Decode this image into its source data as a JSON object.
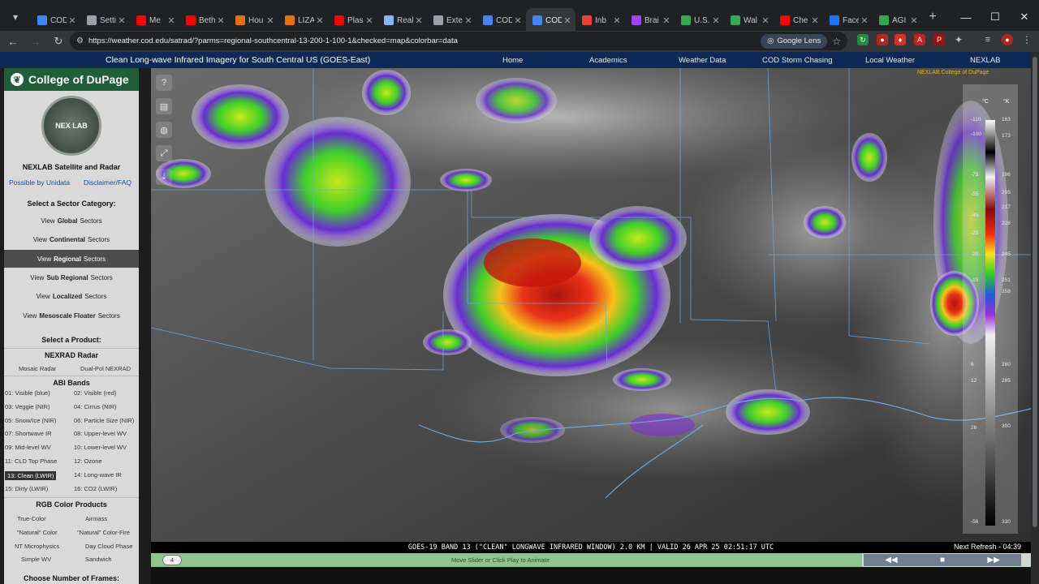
{
  "browser": {
    "tabs": [
      {
        "label": "COD",
        "color": "#4285f4"
      },
      {
        "label": "Setti",
        "color": "#9aa0a6"
      },
      {
        "label": "Me",
        "color": "#ff0000"
      },
      {
        "label": "Beth",
        "color": "#ff0000"
      },
      {
        "label": "Hou",
        "color": "#e8710a"
      },
      {
        "label": "LIZA",
        "color": "#e8710a"
      },
      {
        "label": "Plas",
        "color": "#ff0000"
      },
      {
        "label": "Real",
        "color": "#8ab4f8"
      },
      {
        "label": "Exte",
        "color": "#9aa0a6"
      },
      {
        "label": "COD",
        "color": "#4285f4"
      },
      {
        "label": "COD",
        "color": "#4285f4"
      },
      {
        "label": "Inb",
        "color": "#ea4335"
      },
      {
        "label": "Brai",
        "color": "#a142f4"
      },
      {
        "label": "U.S.",
        "color": "#34a853"
      },
      {
        "label": "Wal",
        "color": "#34a853"
      },
      {
        "label": "Che",
        "color": "#ff0000"
      },
      {
        "label": "Face",
        "color": "#1877f2"
      },
      {
        "label": "AGI",
        "color": "#34a853"
      }
    ],
    "url": "https://weather.cod.edu/satrad/?parms=regional-southcentral-13-200-1-100-1&checked=map&colorbar=data",
    "lens_label": "Google Lens"
  },
  "site": {
    "title": "Clean Long-wave Infrared Imagery for South Central US (GOES-East)",
    "nav": [
      "Home",
      "Academics",
      "Weather Data",
      "COD Storm Chasing",
      "Local Weather",
      "NEXLAB"
    ]
  },
  "sidebar": {
    "brand": "College of DuPage",
    "logo_text": "NEX LAB",
    "heading": "NEXLAB Satellite and Radar",
    "link_unidata": "Possible by Unidata",
    "link_disclaimer": "Disclaimer/FAQ",
    "sector_category_label": "Select a Sector Category:",
    "sectors": [
      {
        "pre": "View",
        "bold": "Global",
        "post": "Sectors"
      },
      {
        "pre": "View",
        "bold": "Continental",
        "post": "Sectors"
      },
      {
        "pre": "View",
        "bold": "Regional",
        "post": "Sectors"
      },
      {
        "pre": "View",
        "bold": "Sub Regional",
        "post": "Sectors"
      },
      {
        "pre": "View",
        "bold": "Localized",
        "post": "Sectors"
      },
      {
        "pre": "View",
        "bold": "Mesoscale Floater",
        "post": "Sectors"
      }
    ],
    "product_label": "Select a Product:",
    "nexrad_label": "NEXRAD Radar",
    "nexrad_items": [
      "Mosaic Radar",
      "Dual-Pol NEXRAD"
    ],
    "abi_label": "ABI Bands",
    "abi_bands": [
      [
        "01: Visible (blue)",
        "02: Visible (red)"
      ],
      [
        "03: Veggie (NIR)",
        "04: Cirrus (NIR)"
      ],
      [
        "05: Snow/Ice (NIR)",
        "06: Particle Size (NIR)"
      ],
      [
        "07: Shortwave IR",
        "08: Upper-level WV"
      ],
      [
        "09: Mid-level WV",
        "10: Lower-level WV"
      ],
      [
        "11: CLD Top Phase",
        "12: Ozone"
      ],
      [
        "13: Clean (LWIR)",
        "14: Long-wave IR"
      ],
      [
        "15: Dirty (LWIR)",
        "16: CO2 (LWIR)"
      ]
    ],
    "rgb_label": "RGB Color Products",
    "rgb_items": [
      [
        "True-Color",
        "Airmass"
      ],
      [
        "\"Natural\" Color",
        "\"Natural\" Color-Fire"
      ],
      [
        "NT Microphysics",
        "Day Cloud Phase"
      ],
      [
        "Simple WV",
        "Sandwich"
      ]
    ],
    "frames_label": "Choose Number of Frames:"
  },
  "map": {
    "watermark": "NEXLAB College of DuPage",
    "caption": "GOES-19 BAND 13 (\"CLEAN\" LONGWAVE INFRARED WINDOW) 2.0 KM | VALID 26 APR 25 02:51:17 UTC",
    "refresh": "Next Refresh - 04:39",
    "slider_value": "4",
    "slider_hint": "Move Slider or Click Play to Animate",
    "colorbar": {
      "unit_c": "°C",
      "unit_k": "°K",
      "celsius_ticks": [
        "-110",
        "-100",
        "-75",
        "-55",
        "-45",
        "-25",
        "-20",
        "-15",
        "6",
        "12",
        "26",
        "-56"
      ],
      "kelvin_ticks": [
        "163",
        "173",
        "196",
        "205",
        "217",
        "228",
        "245",
        "251",
        "258",
        "280",
        "285",
        "300",
        "330"
      ]
    }
  },
  "colors": {
    "sitebar": "#0c2a55",
    "cod_green": "#1f5e36",
    "slider_green": "#8fc48f"
  }
}
